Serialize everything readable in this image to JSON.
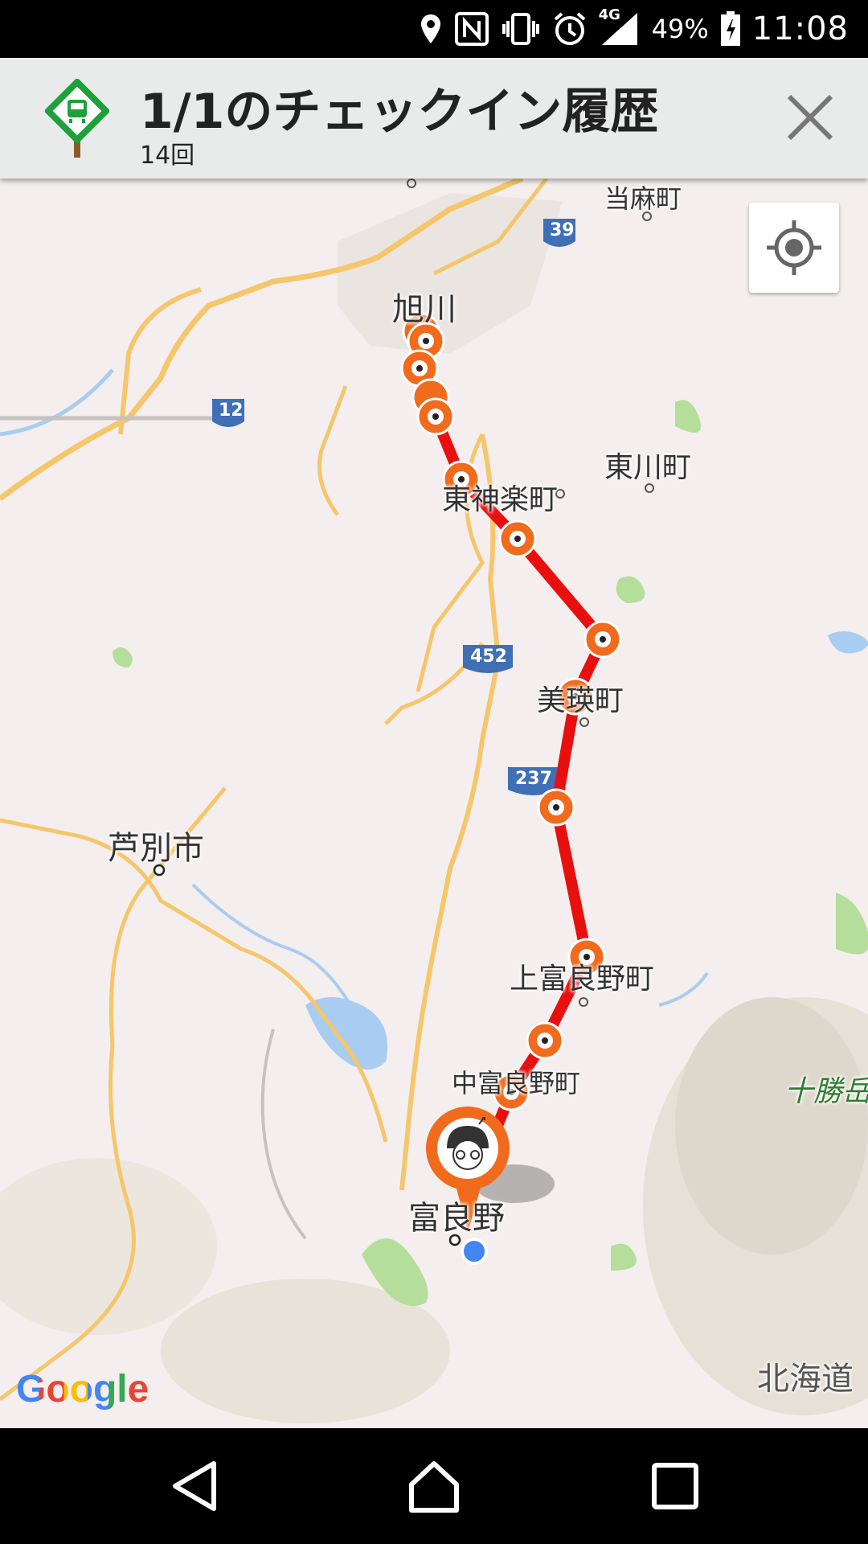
{
  "status_bar": {
    "battery_percent": "49%",
    "network": "4G",
    "time": "11:08",
    "icons": [
      "location-icon",
      "nfc-icon",
      "vibrate-icon",
      "alarm-icon",
      "signal-icon",
      "battery-icon"
    ]
  },
  "header": {
    "title": "1/1のチェックイン履歴",
    "count": "14回",
    "icons": [
      "station-sign-icon",
      "close-icon"
    ]
  },
  "map": {
    "places": {
      "asahikawa": "旭川",
      "touma": "当麻町",
      "higashikawa": "東川町",
      "higashikagura": "東神楽町",
      "biei": "美瑛町",
      "ashibetsu": "芦別市",
      "kamifurano": "上富良野町",
      "nakafurano": "中富良野町",
      "tokachidake": "十勝岳",
      "furano": "富良野",
      "hokkaido": "北海道"
    },
    "routes": {
      "r39": "39",
      "r12": "12",
      "r452": "452",
      "r237": "237"
    },
    "checkin_count": 14,
    "attribution": "Google",
    "colors": {
      "route": "#e8100f",
      "pin": "#f26a1b",
      "user_dot": "#4285f4"
    }
  },
  "nav_bar": {
    "icons": [
      "back-icon",
      "home-icon",
      "recents-icon"
    ]
  }
}
